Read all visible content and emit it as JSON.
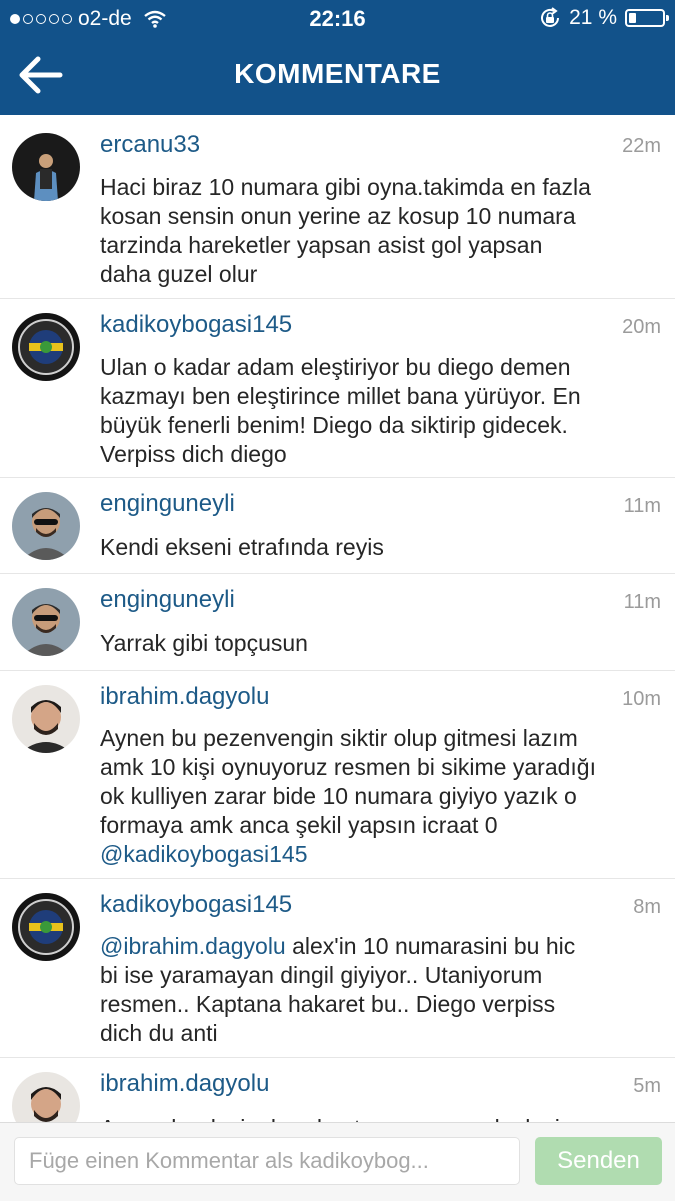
{
  "status_bar": {
    "carrier": "o2-de",
    "time": "22:16",
    "battery": "21 %",
    "battery_level": 0.21
  },
  "header": {
    "title": "KOMMENTARE"
  },
  "comments": [
    {
      "user": "ercanu33",
      "time": "22m",
      "lines": [
        "Haci biraz 10 numara gibi oyna.takimda en fazla",
        "kosan sensin onun yerine az kosup 10 numara",
        "tarzinda hareketler yapsan asist gol yapsan",
        "daha guzel olur"
      ]
    },
    {
      "user": "kadikoybogasi145",
      "time": "20m",
      "lines": [
        "Ulan o kadar adam eleştiriyor bu diego demen",
        "kazmayı ben eleştirince millet bana yürüyor. En",
        "büyük fenerli benim! Diego da siktirip gidecek.",
        "Verpiss dich diego"
      ]
    },
    {
      "user": "enginguneyli",
      "time": "11m",
      "lines": [
        "Kendi ekseni etrafında reyis"
      ]
    },
    {
      "user": "enginguneyli",
      "time": "11m",
      "lines": [
        "Yarrak gibi topçusun"
      ]
    },
    {
      "user": "ibrahim.dagyolu",
      "time": "10m",
      "lines": [
        "Aynen bu pezenvengin siktir olup gitmesi lazım",
        "amk 10 kişi oynuyoruz resmen bi sikime yaradığı",
        "ok kulliyen zarar bide 10 numara giyiyo yazık o",
        "formaya amk anca şekil yapsın icraat 0"
      ],
      "mention_line": "@kadikoybogasi145"
    },
    {
      "user": "kadikoybogasi145",
      "time": "8m",
      "mention": "@ibrahim.dagyolu",
      "first_rest": " alex'in 10 numarasini bu hic",
      "lines": [
        "bi ise yaramayan dingil giyiyor.. Utaniyorum",
        "resmen.. Kaptana hakaret bu.. Diego verpiss",
        "dich du anti"
      ]
    },
    {
      "user": "ibrahim.dagyolu",
      "time": "5m",
      "lines": [
        "Aynen kardesim bende utanıyorum amk alexin"
      ]
    }
  ],
  "compose": {
    "placeholder": "Füge einen Kommentar als kadikoybog...",
    "send_label": "Senden"
  },
  "colors": {
    "header": "#12528a",
    "username": "#1d5a87",
    "send_button": "#b0dcb0"
  }
}
